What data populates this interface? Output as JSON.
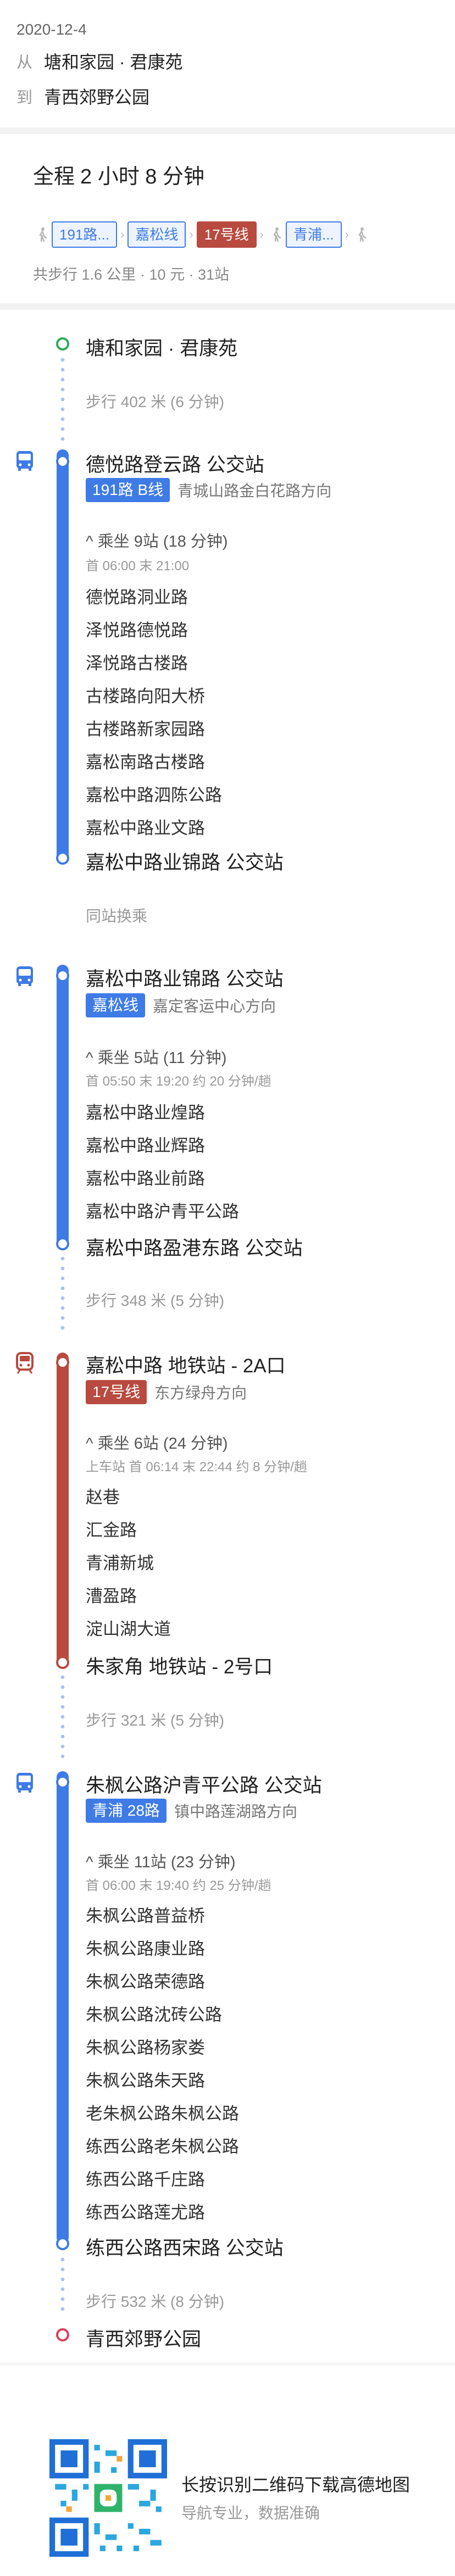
{
  "header": {
    "date": "2020-12-4",
    "from_label": "从",
    "from": "塘和家园 · 君康苑",
    "to_label": "到",
    "to": "青西郊野公园"
  },
  "summary": {
    "total_label": "全程",
    "total_time": "2 小时 8 分钟",
    "details": "共步行 1.6 公里 · 10 元 · 31站",
    "chips": [
      "191路...",
      "嘉松线",
      "17号线",
      "青浦..."
    ]
  },
  "route": {
    "start": "塘和家园 · 君康苑",
    "walk1": "步行 402 米 (6 分钟)",
    "seg1": {
      "board": "德悦路登云路 公交站",
      "line": "191路 B线",
      "direction": "青城山路金白花路方向",
      "ride": "乘坐 9站 (18 分钟)",
      "sched": "首 06:00  末 21:00",
      "stops": [
        "德悦路洞业路",
        "泽悦路德悦路",
        "泽悦路古楼路",
        "古楼路向阳大桥",
        "古楼路新家园路",
        "嘉松南路古楼路",
        "嘉松中路泗陈公路",
        "嘉松中路业文路"
      ],
      "alight": "嘉松中路业锦路 公交站"
    },
    "transfer": "同站换乘",
    "seg2": {
      "board": "嘉松中路业锦路 公交站",
      "line": "嘉松线",
      "direction": "嘉定客运中心方向",
      "ride": "乘坐 5站 (11 分钟)",
      "sched": "首 05:50  末 19:20  约 20 分钟/趟",
      "stops": [
        "嘉松中路业煌路",
        "嘉松中路业辉路",
        "嘉松中路业前路",
        "嘉松中路沪青平公路"
      ],
      "alight": "嘉松中路盈港东路 公交站"
    },
    "walk2": "步行 348 米 (5 分钟)",
    "seg3": {
      "board": "嘉松中路 地铁站 - 2A口",
      "line": "17号线",
      "direction": "东方绿舟方向",
      "ride": "乘坐 6站 (24 分钟)",
      "sched": "上车站 首 06:14  末 22:44  约 8 分钟/趟",
      "stops": [
        "赵巷",
        "汇金路",
        "青浦新城",
        "漕盈路",
        "淀山湖大道"
      ],
      "alight": "朱家角 地铁站 - 2号口"
    },
    "walk3": "步行 321 米 (5 分钟)",
    "seg4": {
      "board": "朱枫公路沪青平公路 公交站",
      "line": "青浦 28路",
      "direction": "镇中路莲湖路方向",
      "ride": "乘坐 11站 (23 分钟)",
      "sched": "首 06:00  末 19:40  约 25 分钟/趟",
      "stops": [
        "朱枫公路普益桥",
        "朱枫公路康业路",
        "朱枫公路荣德路",
        "朱枫公路沈砖公路",
        "朱枫公路杨家娄",
        "朱枫公路朱天路",
        "老朱枫公路朱枫公路",
        "练西公路老朱枫公路",
        "练西公路千庄路",
        "练西公路莲尤路"
      ],
      "alight": "练西公路西宋路 公交站"
    },
    "walk4": "步行 532 米 (8 分钟)",
    "end": "青西郊野公园"
  },
  "footer": {
    "line1": "长按识别二维码下载高德地图",
    "line2": "导航专业，数据准确"
  },
  "colors": {
    "bus": "#3e7be6",
    "metro": "#b84a3f",
    "start": "#2faa5d",
    "end": "#d9415a"
  }
}
